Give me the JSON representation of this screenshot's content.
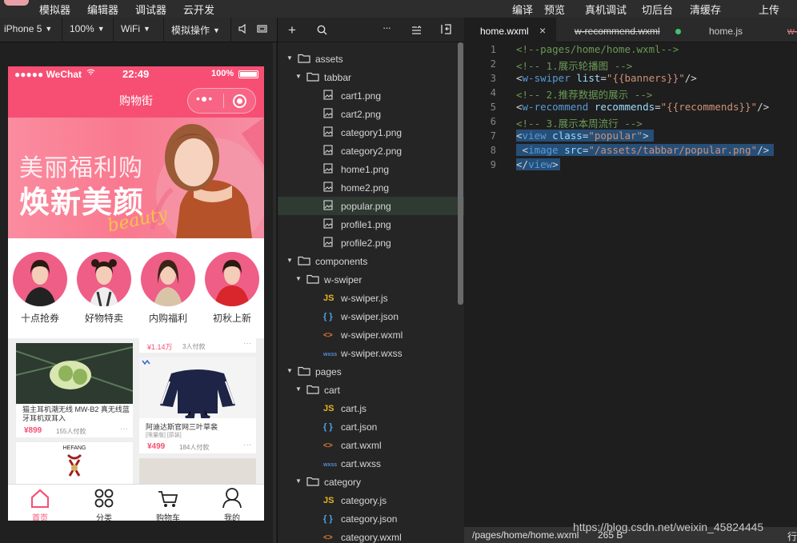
{
  "menu": {
    "left": [
      "模拟器",
      "编辑器",
      "调试器",
      "云开发"
    ],
    "right": [
      "编译",
      "预览",
      "真机调试",
      "切后台",
      "清缓存"
    ],
    "upload": "上传"
  },
  "toolbar": {
    "device": "iPhone 5",
    "zoom": "100%",
    "network": "WiFi",
    "sim_ops": "模拟操作"
  },
  "phone": {
    "status": {
      "carrier": "●●●●● WeChat",
      "time": "22:49",
      "battery": "100%"
    },
    "nav_title": "购物街",
    "banner": {
      "line1": "美丽福利购",
      "line2": "焕新美颜",
      "script": "beauty"
    },
    "recommends": [
      "十点抢券",
      "好物特卖",
      "内购福利",
      "初秋上新"
    ],
    "goods": [
      {
        "title": "猫主耳机潮无线 MW-B2 真无线蓝牙耳机双耳入",
        "price": "¥899",
        "sales": "155人付款"
      },
      {
        "title": "阿迪达斯官网三叶草裴",
        "sub": "[限量版] [原装]",
        "price": "¥499",
        "sales": "184人付款"
      }
    ],
    "goods_top_price": "¥1.14万",
    "goods_top_sales": "3人付款",
    "goods3_brand": "HEFANG",
    "tabs": [
      "首页",
      "分类",
      "购物车",
      "我的"
    ],
    "active_tab": "首页",
    "accent": "#f74f74"
  },
  "explorer": {
    "items": [
      {
        "name": "assets",
        "type": "folder",
        "depth": 0
      },
      {
        "name": "tabbar",
        "type": "folder",
        "depth": 1
      },
      {
        "name": "cart1.png",
        "type": "image",
        "depth": 2
      },
      {
        "name": "cart2.png",
        "type": "image",
        "depth": 2
      },
      {
        "name": "category1.png",
        "type": "image",
        "depth": 2
      },
      {
        "name": "category2.png",
        "type": "image",
        "depth": 2
      },
      {
        "name": "home1.png",
        "type": "image",
        "depth": 2
      },
      {
        "name": "home2.png",
        "type": "image",
        "depth": 2
      },
      {
        "name": "popular.png",
        "type": "image",
        "depth": 2,
        "selected": true
      },
      {
        "name": "profile1.png",
        "type": "image",
        "depth": 2
      },
      {
        "name": "profile2.png",
        "type": "image",
        "depth": 2
      },
      {
        "name": "components",
        "type": "folder",
        "depth": 0
      },
      {
        "name": "w-swiper",
        "type": "folder",
        "depth": 1
      },
      {
        "name": "w-swiper.js",
        "type": "js",
        "depth": 2
      },
      {
        "name": "w-swiper.json",
        "type": "json",
        "depth": 2
      },
      {
        "name": "w-swiper.wxml",
        "type": "wxml",
        "depth": 2
      },
      {
        "name": "w-swiper.wxss",
        "type": "wxss",
        "depth": 2
      },
      {
        "name": "pages",
        "type": "folder",
        "depth": 0
      },
      {
        "name": "cart",
        "type": "folder",
        "depth": 1
      },
      {
        "name": "cart.js",
        "type": "js",
        "depth": 2
      },
      {
        "name": "cart.json",
        "type": "json",
        "depth": 2
      },
      {
        "name": "cart.wxml",
        "type": "wxml",
        "depth": 2
      },
      {
        "name": "cart.wxss",
        "type": "wxss",
        "depth": 2
      },
      {
        "name": "category",
        "type": "folder",
        "depth": 1
      },
      {
        "name": "category.js",
        "type": "js",
        "depth": 2
      },
      {
        "name": "category.json",
        "type": "json",
        "depth": 2
      },
      {
        "name": "category.wxml",
        "type": "wxml",
        "depth": 2
      }
    ]
  },
  "editor": {
    "tabs": [
      {
        "name": "home.wxml",
        "active": true,
        "close": "×"
      },
      {
        "name": "w-recommend.wxml",
        "strike": true,
        "dot": true
      },
      {
        "name": "home.js"
      },
      {
        "name": "w-re",
        "strike": true
      }
    ],
    "lines": [
      {
        "n": "1",
        "tokens": [
          [
            "c-com",
            "<!--pages/home/home.wxml-->"
          ]
        ]
      },
      {
        "n": "2",
        "tokens": [
          [
            "c-com",
            "<!-- 1.展示轮播图 -->"
          ]
        ]
      },
      {
        "n": "3",
        "tokens": [
          [
            "c-pun",
            "<"
          ],
          [
            "c-tag",
            "w-swiper"
          ],
          [
            "c-pun",
            " "
          ],
          [
            "c-attr",
            "list"
          ],
          [
            "c-pun",
            "="
          ],
          [
            "c-str",
            "\"{{banners}}\""
          ],
          [
            "c-pun",
            "/>"
          ]
        ]
      },
      {
        "n": "4",
        "tokens": [
          [
            "c-com",
            "<!-- 2.推荐数据的展示 -->"
          ]
        ]
      },
      {
        "n": "5",
        "tokens": [
          [
            "c-pun",
            "<"
          ],
          [
            "c-tag",
            "w-recommend"
          ],
          [
            "c-pun",
            " "
          ],
          [
            "c-attr",
            "recommends"
          ],
          [
            "c-pun",
            "="
          ],
          [
            "c-str",
            "\"{{recommends}}\""
          ],
          [
            "c-pun",
            "/>"
          ]
        ]
      },
      {
        "n": "6",
        "tokens": [
          [
            "c-com",
            "<!-- 3.展示本周流行 -->"
          ]
        ]
      },
      {
        "n": "7",
        "sel": true,
        "tokens": [
          [
            "c-pun",
            "<"
          ],
          [
            "c-tag",
            "view"
          ],
          [
            "c-pun",
            " "
          ],
          [
            "c-attr",
            "class"
          ],
          [
            "c-pun",
            "="
          ],
          [
            "c-str",
            "\"popular\""
          ],
          [
            "c-pun",
            ">"
          ]
        ]
      },
      {
        "n": "8",
        "sel": true,
        "tokens": [
          [
            "c-pun",
            " <"
          ],
          [
            "c-tag",
            "image"
          ],
          [
            "c-pun",
            " "
          ],
          [
            "c-attr",
            "src"
          ],
          [
            "c-pun",
            "="
          ],
          [
            "c-str",
            "\"/assets/tabbar/popular.png\""
          ],
          [
            "c-pun",
            "/>"
          ]
        ]
      },
      {
        "n": "9",
        "sel": true,
        "tokens": [
          [
            "c-pun",
            "</"
          ],
          [
            "c-tag",
            "view"
          ],
          [
            "c-pun",
            ">"
          ]
        ]
      }
    ],
    "status_path": "/pages/home/home.wxml",
    "status_size": "265 B",
    "status_right": "行"
  },
  "watermark": "https://blog.csdn.net/weixin_45824445"
}
